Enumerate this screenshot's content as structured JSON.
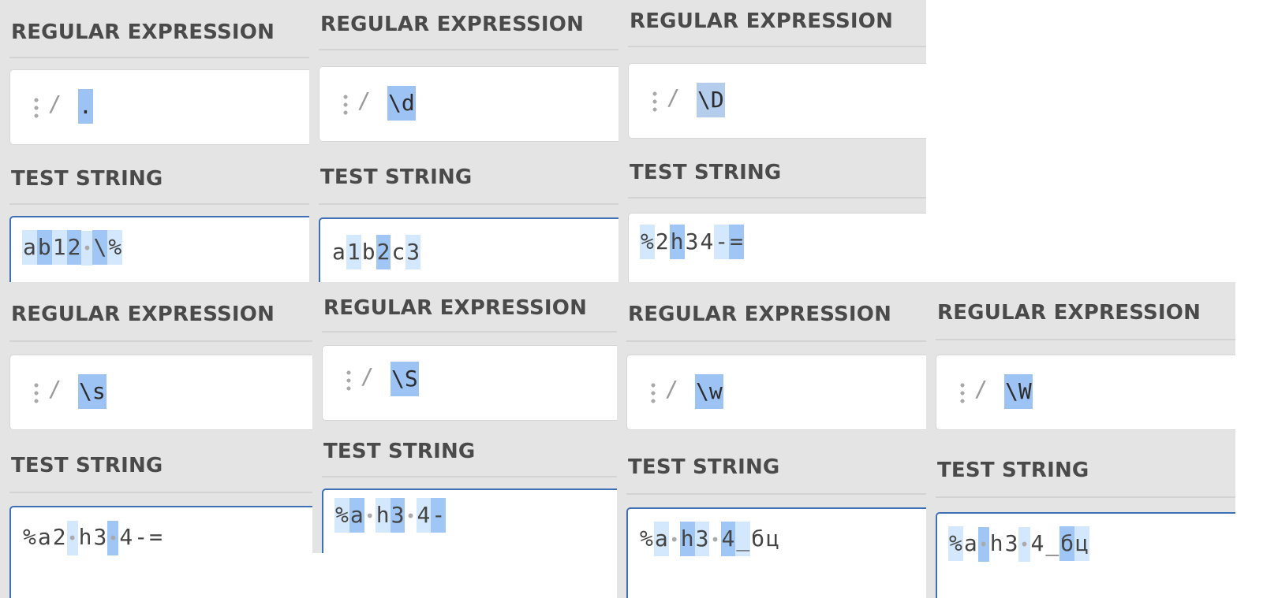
{
  "panels": [
    {
      "regex_heading": "REGULAR EXPRESSION",
      "regex": ".",
      "test_heading": "TEST STRING",
      "test_string": [
        {
          "t": "a",
          "m": 1
        },
        {
          "t": "b",
          "m": 2
        },
        {
          "t": "1",
          "m": 1
        },
        {
          "t": "2",
          "m": 2
        },
        {
          "t": "•",
          "m": 1,
          "s": true
        },
        {
          "t": "\\",
          "m": 2
        },
        {
          "t": "%",
          "m": 1
        }
      ]
    },
    {
      "regex_heading": "REGULAR EXPRESSION",
      "regex": "\\d",
      "test_heading": "TEST STRING",
      "test_string": [
        {
          "t": "a",
          "m": 0
        },
        {
          "t": "1",
          "m": 1
        },
        {
          "t": "b",
          "m": 0
        },
        {
          "t": "2",
          "m": 2
        },
        {
          "t": "c",
          "m": 0
        },
        {
          "t": "3",
          "m": 1
        }
      ]
    },
    {
      "regex_heading": "REGULAR EXPRESSION",
      "regex": "\\D",
      "test_heading": "TEST STRING",
      "test_string": [
        {
          "t": "%",
          "m": 1
        },
        {
          "t": "2",
          "m": 0
        },
        {
          "t": "h",
          "m": 2
        },
        {
          "t": "3",
          "m": 0
        },
        {
          "t": "4",
          "m": 0
        },
        {
          "t": "-",
          "m": 1
        },
        {
          "t": "=",
          "m": 2
        }
      ]
    },
    {
      "regex_heading": "REGULAR EXPRESSION",
      "regex": "\\s",
      "test_heading": "TEST STRING",
      "test_string": [
        {
          "t": "%",
          "m": 0
        },
        {
          "t": "a",
          "m": 0
        },
        {
          "t": "2",
          "m": 0
        },
        {
          "t": "•",
          "m": 1,
          "s": true
        },
        {
          "t": "h",
          "m": 0
        },
        {
          "t": "3",
          "m": 0
        },
        {
          "t": "•",
          "m": 2,
          "s": true
        },
        {
          "t": "4",
          "m": 0
        },
        {
          "t": "-",
          "m": 0
        },
        {
          "t": "=",
          "m": 0
        }
      ]
    },
    {
      "regex_heading": "REGULAR EXPRESSION",
      "regex": "\\S",
      "test_heading": "TEST STRING",
      "test_string": [
        {
          "t": "%",
          "m": 1
        },
        {
          "t": "a",
          "m": 2
        },
        {
          "t": "•",
          "m": 0,
          "s": true
        },
        {
          "t": "h",
          "m": 1
        },
        {
          "t": "3",
          "m": 2
        },
        {
          "t": "•",
          "m": 0,
          "s": true
        },
        {
          "t": "4",
          "m": 1
        },
        {
          "t": "-",
          "m": 2
        }
      ]
    },
    {
      "regex_heading": "REGULAR EXPRESSION",
      "regex": "\\w",
      "test_heading": "TEST STRING",
      "test_string": [
        {
          "t": "%",
          "m": 0
        },
        {
          "t": "a",
          "m": 1
        },
        {
          "t": "•",
          "m": 0,
          "s": true
        },
        {
          "t": "h",
          "m": 2
        },
        {
          "t": "3",
          "m": 1
        },
        {
          "t": "•",
          "m": 0,
          "s": true
        },
        {
          "t": "4",
          "m": 2
        },
        {
          "t": "_",
          "m": 1
        },
        {
          "t": "б",
          "m": 0
        },
        {
          "t": "ц",
          "m": 0
        }
      ]
    },
    {
      "regex_heading": "REGULAR EXPRESSION",
      "regex": "\\W",
      "test_heading": "TEST STRING",
      "test_string": [
        {
          "t": "%",
          "m": 1
        },
        {
          "t": "a",
          "m": 0
        },
        {
          "t": "•",
          "m": 2,
          "s": true
        },
        {
          "t": "h",
          "m": 0
        },
        {
          "t": "3",
          "m": 0
        },
        {
          "t": "•",
          "m": 1,
          "s": true
        },
        {
          "t": "4",
          "m": 0
        },
        {
          "t": "_",
          "m": 0
        },
        {
          "t": "б",
          "m": 2
        },
        {
          "t": "ц",
          "m": 1
        }
      ]
    }
  ]
}
